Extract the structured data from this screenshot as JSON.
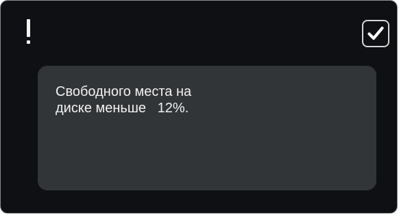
{
  "dialog": {
    "icon": "exclamation-icon",
    "confirm_icon": "checkmark-icon",
    "message_line1": "Свободного места на",
    "message_line2": "диске меньше   12%."
  }
}
